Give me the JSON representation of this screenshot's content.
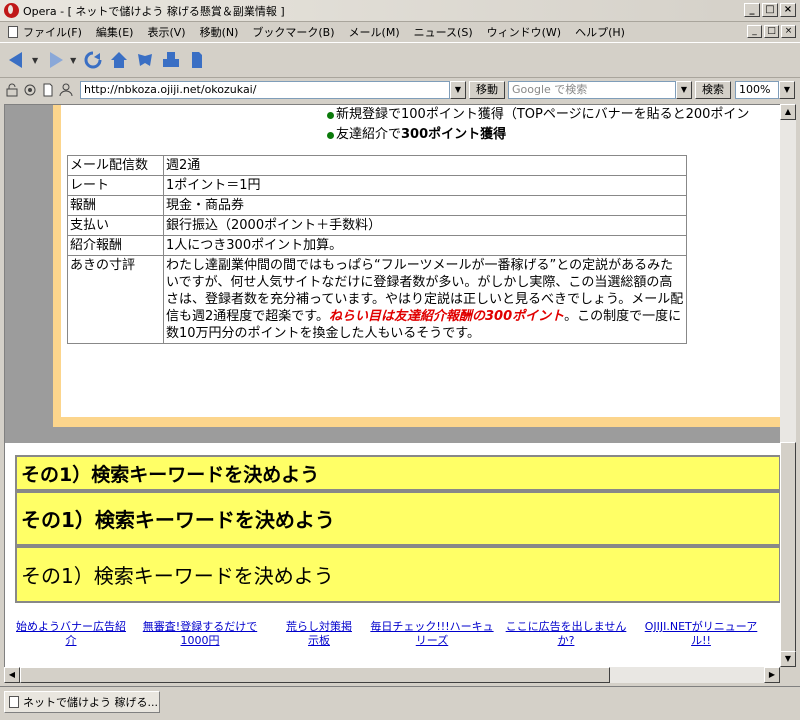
{
  "window": {
    "title": "Opera - [ ネットで儲けよう 稼げる懸賞＆副業情報 ]",
    "minimize": "_",
    "maximize": "□",
    "close": "×"
  },
  "menu": {
    "items": [
      "ファイル(F)",
      "編集(E)",
      "表示(V)",
      "移動(N)",
      "ブックマーク(B)",
      "メール(M)",
      "ニュース(S)",
      "ウィンドウ(W)",
      "ヘルプ(H)"
    ]
  },
  "toolbar": {
    "icons": [
      "back-icon",
      "forward-icon",
      "reload-icon",
      "home-icon",
      "hotlist-icon",
      "print-icon",
      "document-icon"
    ]
  },
  "address": {
    "url": "http://nbkoza.ojiji.net/okozukai/",
    "go_label": "移動",
    "search_placeholder": "Google で検索",
    "search_label": "検索",
    "zoom": "100%"
  },
  "page": {
    "bullets": [
      {
        "text": "新規登録で100ポイント獲得（TOPページにバナーを貼ると200ポイン",
        "bold": ""
      },
      {
        "text": "友達紹介で",
        "bold": "300ポイント獲得"
      }
    ],
    "table": [
      {
        "key": "メール配信数",
        "value": "週2通"
      },
      {
        "key": "レート",
        "value": "1ポイント＝1円"
      },
      {
        "key": "報酬",
        "value": "現金・商品券"
      },
      {
        "key": "支払い",
        "value": "銀行振込（2000ポイント＋手数料）"
      },
      {
        "key": "紹介報酬",
        "value": "1人につき300ポイント加算。"
      },
      {
        "key": "あきの寸評",
        "value_pre": "わたし達副業仲間の間ではもっぱら“フルーツメールが一番稼げる”との定説があるみたいですが、何せ人気サイトなだけに登録者数が多い。がしかし実際、この当選総額の高さは、登録者数を充分補っています。やはり定説は正しいと見るべきでしょう。メール配信も週2通程度で超楽です。",
        "value_em": "ねらい目は友達紹介報酬の300ポイント",
        "value_post": "。この制度で一度に数10万円分のポイントを換金した人もいるそうです。"
      }
    ],
    "sections": [
      "その1）検索キーワードを決めよう",
      "その1）検索キーワードを決めよう",
      "その1）検索キーワードを決めよう"
    ],
    "footer_links": [
      "始めようバナー広告紹介",
      "無審査!登録するだけで1000円",
      "荒らし対策掲示板",
      "毎日チェック!!!ハーキュリーズ",
      "ここに広告を出しませんか?",
      "OJIJI.NETがリニューアル!!"
    ]
  },
  "tab": {
    "title": "ネットで儲けよう 稼げる..."
  }
}
